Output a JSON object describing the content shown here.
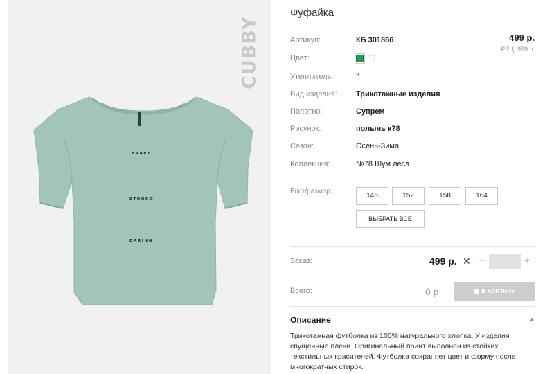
{
  "product": {
    "brand": "CUBBY",
    "print_lines": [
      "BRAVE",
      "STRONG",
      "DARING"
    ],
    "title": "Фуфайка",
    "price": "499 р.",
    "rrp": "РРЦ: 999 р."
  },
  "attributes": [
    {
      "label": "Артикул:",
      "value": "КБ 301866"
    },
    {
      "label": "Цвет:",
      "value": ""
    },
    {
      "label": "Утеплитель:",
      "value": "\""
    },
    {
      "label": "Вид изделия:",
      "value": "Трикотажные изделия"
    },
    {
      "label": "Полотно:",
      "value": "Супрем"
    },
    {
      "label": "Рисунок:",
      "value": "полынь к78"
    },
    {
      "label": "Сезон:",
      "value": "Осень-Зима"
    },
    {
      "label": "Коллекция:",
      "value": "№78 Шум леса"
    }
  ],
  "colors": [
    "#2a9a53",
    "#ffffff"
  ],
  "sizes": {
    "label": "Рост/размер:",
    "options": [
      "146",
      "152",
      "158",
      "164"
    ],
    "select_all": "ВЫБРАТЬ ВСЕ"
  },
  "order": {
    "label": "Заказ:",
    "price": "499 р.",
    "times": "✕",
    "minus": "–",
    "plus": "+",
    "quantity": ""
  },
  "total": {
    "label": "Всего:",
    "value": "0 р.",
    "cart_button": "В КОРЗИНУ"
  },
  "description": {
    "heading": "Описание",
    "text": "Трикотажная футболка из 100% натурального хлопка. У изделия спущенные плечи. Оригинальный принт выполнен из стойких текстильных красителей. Футболка сохраняет цвет и форму после многократных стирок."
  }
}
